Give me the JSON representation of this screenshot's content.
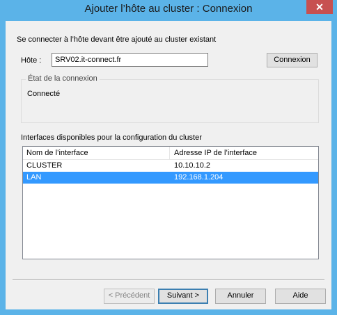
{
  "window": {
    "title": "Ajouter l’hôte au cluster : Connexion",
    "close_icon": "close-icon",
    "accent": "#5bb3e8"
  },
  "intro_text": "Se connecter à l’hôte devant être ajouté au cluster existant",
  "host": {
    "label": "Hôte :",
    "value": "SRV02.it-connect.fr",
    "connect_button": "Connexion"
  },
  "connection_state": {
    "legend": "État de la connexion",
    "status": "Connecté"
  },
  "interfaces": {
    "caption": "Interfaces disponibles pour la configuration du cluster",
    "columns": [
      "Nom de l’interface",
      "Adresse IP de l’interface"
    ],
    "rows": [
      {
        "name": "CLUSTER",
        "ip": "10.10.10.2",
        "selected": false
      },
      {
        "name": "LAN",
        "ip": "192.168.1.204",
        "selected": true
      }
    ]
  },
  "buttons": {
    "previous": "< Précédent",
    "next": "Suivant >",
    "cancel": "Annuler",
    "help": "Aide"
  }
}
